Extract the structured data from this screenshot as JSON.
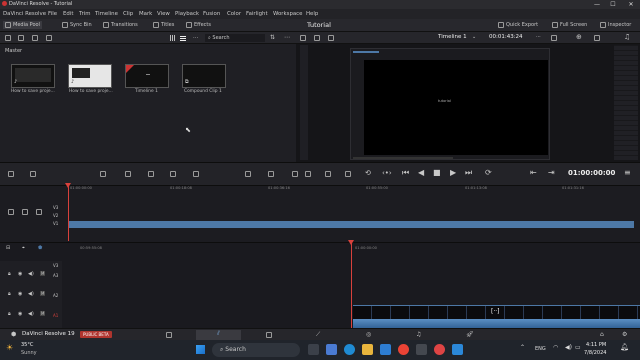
{
  "window": {
    "title": "DaVinci Resolve - Tutorial",
    "min": "—",
    "max": "☐",
    "close": "✕"
  },
  "menu": [
    "DaVinci Resolve",
    "File",
    "Edit",
    "Trim",
    "Timeline",
    "Clip",
    "Mark",
    "View",
    "Playback",
    "Fusion",
    "Color",
    "Fairlight",
    "Workspace",
    "Help"
  ],
  "toolbar": {
    "media_pool": "Media Pool",
    "sync_bin": "Sync Bin",
    "transitions": "Transitions",
    "titles": "Titles",
    "effects": "Effects",
    "project_name": "Tutorial",
    "quick_export": "Quick Export",
    "full_screen": "Full Screen",
    "inspector": "Inspector"
  },
  "media_pool": {
    "search_placeholder": "Search",
    "bin_label": "Master",
    "clips": [
      {
        "label": "How to save proje..."
      },
      {
        "label": "How to save proje..."
      },
      {
        "label": "Timeline 1"
      },
      {
        "label": "Compound Clip 1"
      }
    ]
  },
  "viewer": {
    "timeline_name": "Timeline 1",
    "timecode": "00:01:43:24",
    "screen_text": "tutorial"
  },
  "transport": {
    "timecode": "01:00:00:00"
  },
  "ruler_top": [
    "01:00:00:00",
    "01:00:18:08",
    "01:00:36:16",
    "01:00:55:00",
    "01:01:13:08",
    "01:01:31:16"
  ],
  "ruler_bottom": [
    "00:59:55:08",
    "01:00:00:00"
  ],
  "tracks_top": [
    "V3",
    "V2",
    "V1"
  ],
  "tracks_bottom": [
    "V3",
    "A3",
    "A2",
    "A1"
  ],
  "pagebar": {
    "app_name": "DaVinci Resolve 19",
    "badge": "PUBLIC BETA"
  },
  "taskbar": {
    "weather_temp": "35°C",
    "weather_desc": "Sunny",
    "search_label": "Search",
    "lang": "ENG",
    "time": "4:11 PM",
    "date": "7/8/2024"
  },
  "colors": {
    "accent_blue": "#4d78a6",
    "playhead": "#d8413c",
    "beta_badge": "#b0352e"
  }
}
